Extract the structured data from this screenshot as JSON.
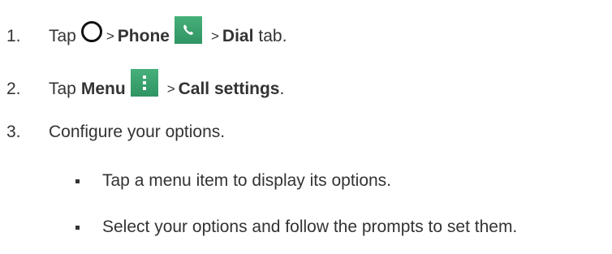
{
  "steps": [
    {
      "number": "1.",
      "tap": "Tap",
      "sep1": ">",
      "phone": "Phone",
      "sep2": ">",
      "dial": "Dial",
      "tab": "tab."
    },
    {
      "number": "2.",
      "tap": "Tap",
      "menu": "Menu",
      "sep": ">",
      "call_settings": "Call settings",
      "period": "."
    },
    {
      "number": "3.",
      "text": "Configure your options."
    }
  ],
  "bullets": [
    "Tap a menu item to display its options.",
    "Select your options and follow the prompts to set them."
  ],
  "icons": {
    "home": "home-circle-icon",
    "phone": "phone-app-icon",
    "menu": "menu-dots-icon"
  },
  "colors": {
    "icon_green": "#3aa16d",
    "text": "#333333"
  }
}
